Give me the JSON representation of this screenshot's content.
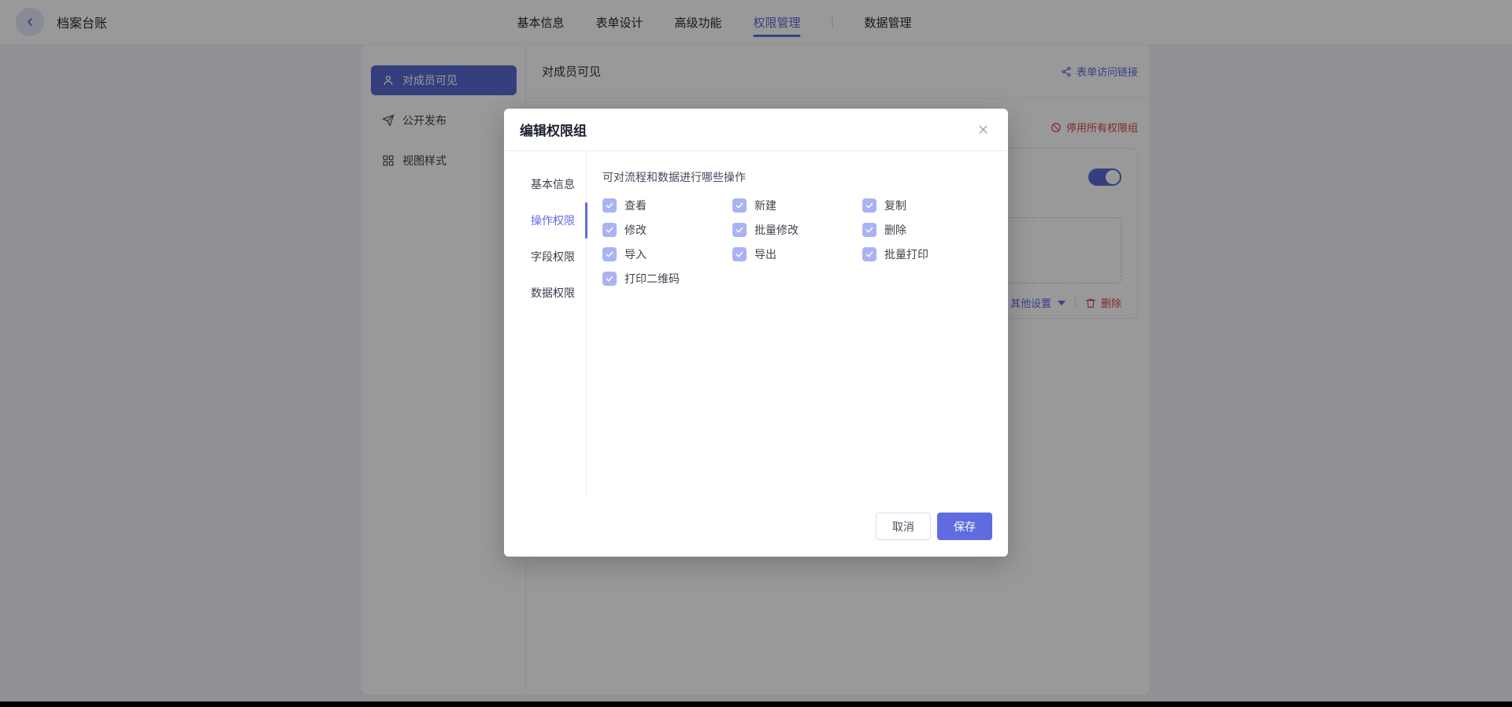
{
  "colors": {
    "accent": "#5e6ce0",
    "sidebar_active_bg": "#5b69d2",
    "danger": "#d9434e",
    "checkbox_checked_disabled": "#a9b3f4"
  },
  "header": {
    "title": "档案台账",
    "tabs": [
      {
        "label": "基本信息",
        "active": false
      },
      {
        "label": "表单设计",
        "active": false
      },
      {
        "label": "高级功能",
        "active": false
      },
      {
        "label": "权限管理",
        "active": true
      },
      {
        "label": "数据管理",
        "active": false
      }
    ]
  },
  "sidebar": {
    "items": [
      {
        "label": "对成员可见",
        "icon": "user-icon",
        "active": true
      },
      {
        "label": "公开发布",
        "icon": "send-icon",
        "active": false
      },
      {
        "label": "视图样式",
        "icon": "grid-icon",
        "active": false
      }
    ]
  },
  "main": {
    "section_title": "对成员可见",
    "form_link_label": "表单访问链接",
    "form_link_icon": "share-icon",
    "disable_all_label": "停用所有权限组",
    "disable_all_icon": "ban-icon",
    "group": {
      "toggle_state": "on",
      "other_settings_label": "其他设置",
      "delete_label": "删除",
      "delete_icon": "trash-icon"
    }
  },
  "modal": {
    "title": "编辑权限组",
    "close_icon": "close-icon",
    "tabs": [
      {
        "label": "基本信息",
        "active": false
      },
      {
        "label": "操作权限",
        "active": true
      },
      {
        "label": "字段权限",
        "active": false
      },
      {
        "label": "数据权限",
        "active": false
      }
    ],
    "section_label": "可对流程和数据进行哪些操作",
    "permissions": [
      {
        "label": "查看",
        "checked": true
      },
      {
        "label": "新建",
        "checked": true
      },
      {
        "label": "复制",
        "checked": true
      },
      {
        "label": "修改",
        "checked": true
      },
      {
        "label": "批量修改",
        "checked": true
      },
      {
        "label": "删除",
        "checked": true
      },
      {
        "label": "导入",
        "checked": true
      },
      {
        "label": "导出",
        "checked": true
      },
      {
        "label": "批量打印",
        "checked": true
      },
      {
        "label": "打印二维码",
        "checked": true
      }
    ],
    "cancel_label": "取消",
    "save_label": "保存"
  }
}
